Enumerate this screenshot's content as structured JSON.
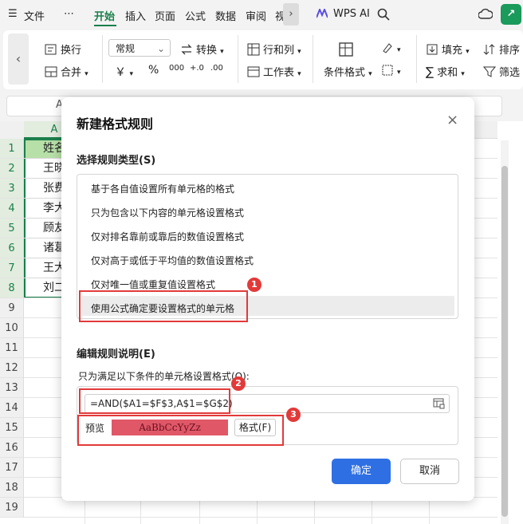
{
  "menubar": {
    "hamburger": "☰",
    "file": "文件",
    "more": "⋯",
    "tabs": [
      "开始",
      "插入",
      "页面",
      "公式",
      "数据",
      "审阅",
      "视"
    ],
    "chevron": "›",
    "wps_ai": "WPS AI"
  },
  "ribbon": {
    "wrap": "换行",
    "merge": "合并",
    "number_format": "常规",
    "convert": "转换",
    "row_col": "行和列",
    "worksheet": "工作表",
    "cond_format": "条件格式",
    "fill": "填充",
    "sort": "排序",
    "sum": "求和",
    "filter": "筛选",
    "currency": "￥",
    "percent": "%",
    "thousands": "000",
    "dec_inc": "+.0",
    "dec_dec": ".00"
  },
  "namebox": {
    "text": "A"
  },
  "sheet": {
    "col_a": "A",
    "rows": [
      "1",
      "2",
      "3",
      "4",
      "5",
      "6",
      "7",
      "8",
      "9",
      "10",
      "11",
      "12",
      "13",
      "14",
      "15",
      "16",
      "17",
      "18",
      "19"
    ],
    "col_a_cells": [
      "姓名",
      "王晓",
      "张费",
      "李大",
      "顾友",
      "诸葛",
      "王大",
      "刘二"
    ]
  },
  "dialog": {
    "title": "新建格式规则",
    "close": "×",
    "rule_type_label": "选择规则类型(S)",
    "rule_types": [
      "基于各自值设置所有单元格的格式",
      "只为包含以下内容的单元格设置格式",
      "仅对排名靠前或靠后的数值设置格式",
      "仅对高于或低于平均值的数值设置格式",
      "仅对唯一值或重复值设置格式",
      "使用公式确定要设置格式的单元格"
    ],
    "edit_label": "编辑规则说明(E)",
    "condition_label": "只为满足以下条件的单元格设置格式(O):",
    "formula": "=AND($A1=$F$3,A$1=$G$2)",
    "preview_label": "预览",
    "preview_sample": "AaBbCcYyZz",
    "format_button": "格式(F)",
    "ok": "确定",
    "cancel": "取消"
  },
  "annotations": {
    "badge1": "1",
    "badge2": "2",
    "badge3": "3"
  },
  "colors": {
    "accent_green": "#1a7f4b",
    "header_fill": "#b7dfa8",
    "preview_fill": "#e05868",
    "ok_blue": "#2f6fe4",
    "annotation_red": "#e23a3a"
  }
}
